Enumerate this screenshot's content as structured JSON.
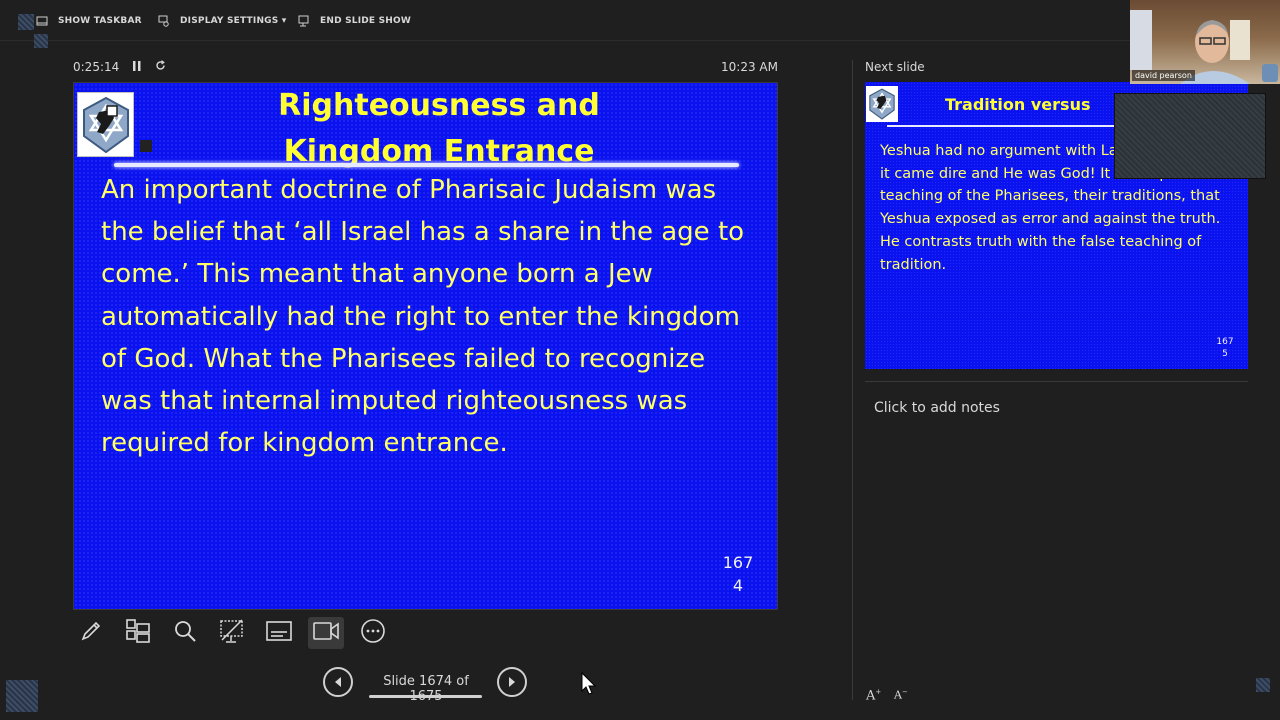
{
  "toolbar": {
    "show_taskbar": "SHOW TASKBAR",
    "display_settings": "DISPLAY SETTINGS ▾",
    "end_slide_show": "END SLIDE SHOW"
  },
  "timer": {
    "elapsed": "0:25:14",
    "clock": "10:23 AM"
  },
  "current_slide": {
    "title_line1": "Righteousness and",
    "title_line2": "Kingdom Entrance",
    "body": "An important doctrine of Pharisaic Judaism was the belief that ‘all Israel has a share in the age to come.’ This meant that anyone born a Jew automatically had the right to enter the kingdom of God. What the Pharisees failed to recognize was that internal imputed righteousness was required for kingdom entrance.",
    "number_line1": "167",
    "number_line2": "4"
  },
  "navigation": {
    "label": "Slide 1674 of 1675"
  },
  "next_slide": {
    "header": "Next slide",
    "title": "Tradition versus",
    "body": "Yeshua had no argument with Law of Moses, for it came dire and He was God! It is the perverse teaching of the Pharisees, their traditions, that Yeshua exposed as error and against the truth. He contrasts truth with the false teaching of tradition.",
    "number_line1": "167",
    "number_line2": "5"
  },
  "notes": {
    "placeholder": "Click to add notes"
  },
  "font_controls": {
    "increase": "A",
    "decrease": "A"
  },
  "webcam": {
    "name": "david pearson"
  },
  "colors": {
    "slide_bg": "#0a12f0",
    "slide_title": "#ffff33",
    "slide_text": "#ffff66"
  }
}
